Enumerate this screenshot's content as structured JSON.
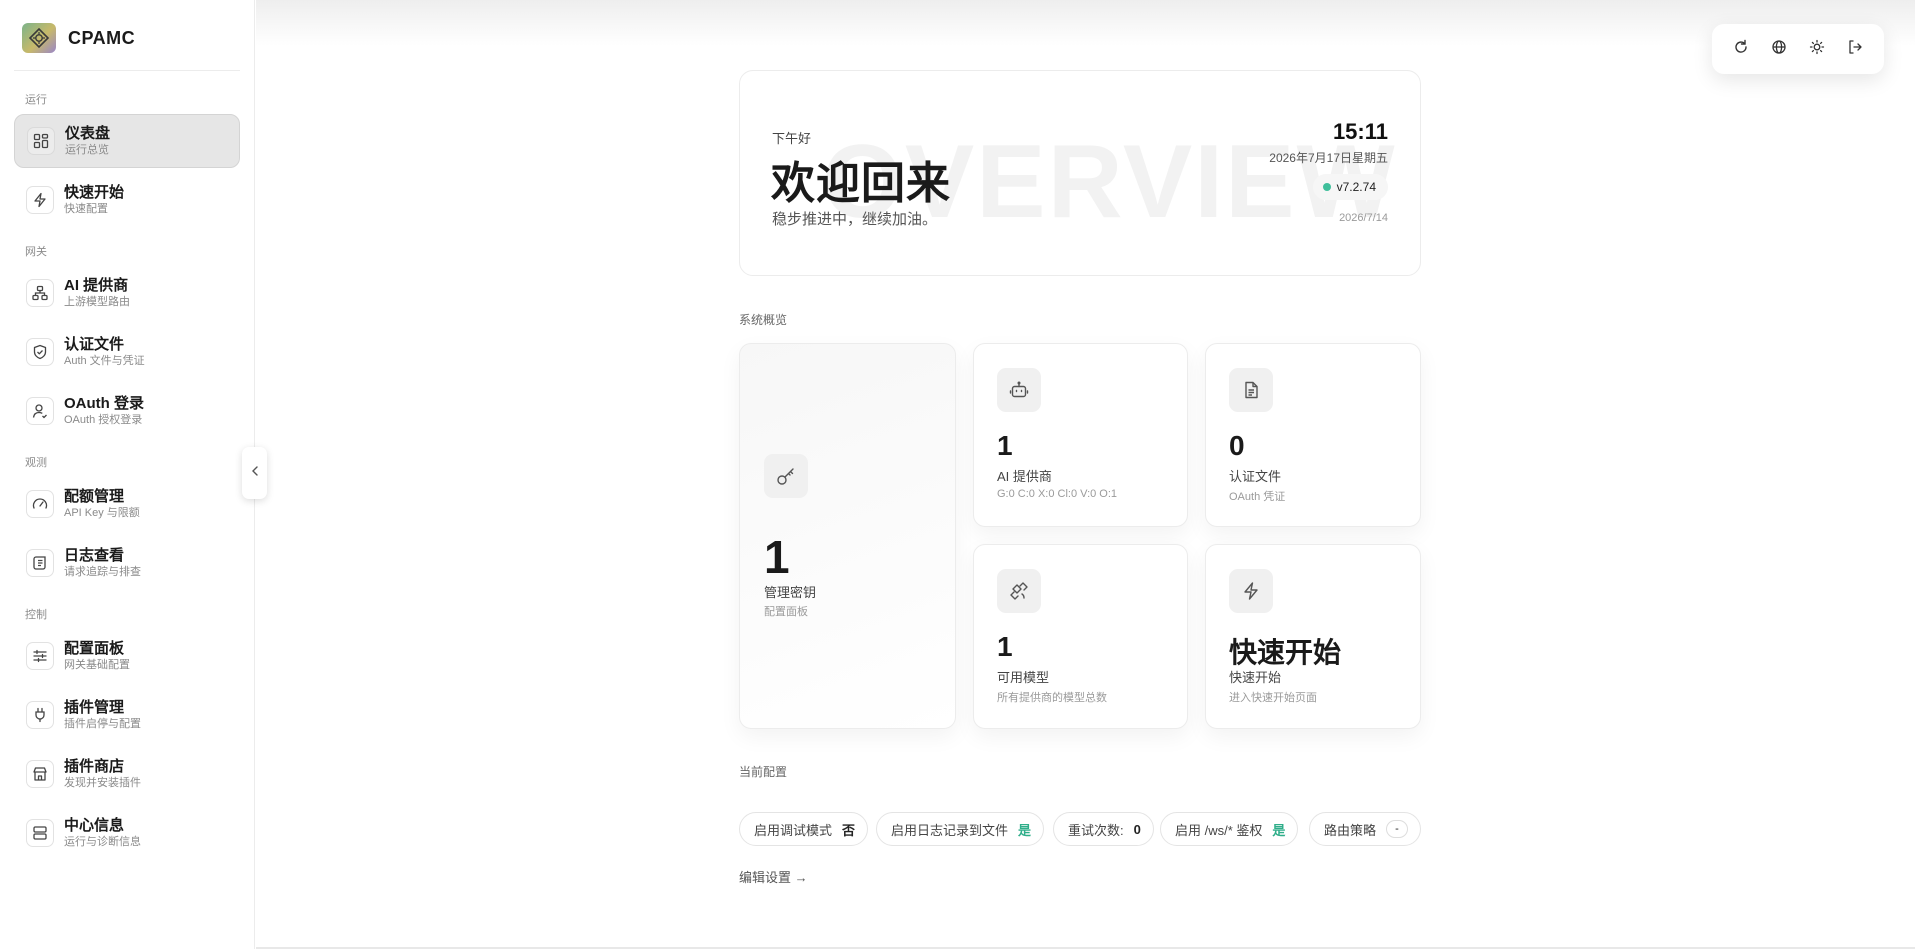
{
  "brand": {
    "name": "CPAMC"
  },
  "sidebar": {
    "sections": {
      "run": "运行",
      "gateway": "网关",
      "observe": "观测",
      "control": "控制"
    },
    "items": [
      {
        "title": "仪表盘",
        "sub": "运行总览",
        "icon": "dashboard-icon",
        "active": true
      },
      {
        "title": "快速开始",
        "sub": "快速配置",
        "icon": "lightning-icon"
      },
      {
        "title": "AI 提供商",
        "sub": "上游模型路由",
        "icon": "network-icon"
      },
      {
        "title": "认证文件",
        "sub": "Auth 文件与凭证",
        "icon": "shield-icon"
      },
      {
        "title": "OAuth 登录",
        "sub": "OAuth 授权登录",
        "icon": "user-icon"
      },
      {
        "title": "配额管理",
        "sub": "API Key 与限额",
        "icon": "gauge-icon"
      },
      {
        "title": "日志查看",
        "sub": "请求追踪与排查",
        "icon": "scroll-icon"
      },
      {
        "title": "配置面板",
        "sub": "网关基础配置",
        "icon": "sliders-icon"
      },
      {
        "title": "插件管理",
        "sub": "插件启停与配置",
        "icon": "plug-icon"
      },
      {
        "title": "插件商店",
        "sub": "发现并安装插件",
        "icon": "store-icon"
      },
      {
        "title": "中心信息",
        "sub": "运行与诊断信息",
        "icon": "server-icon"
      }
    ]
  },
  "toolbar": {
    "icons": [
      "refresh-icon",
      "globe-icon",
      "sun-icon",
      "logout-icon"
    ]
  },
  "welcome": {
    "watermark": "OVERVIEW",
    "greeting": "下午好",
    "title": "欢迎回来",
    "subtitle": "稳步推进中，继续加油。",
    "time": "15:11",
    "date": "2026年7月17日星期五",
    "version": "v7.2.74",
    "build_date": "2026/7/14",
    "status_color": "#3fbf9b"
  },
  "overview": {
    "label": "系统概览",
    "cards": {
      "keys": {
        "value": "1",
        "label": "管理密钥",
        "sub": "配置面板",
        "icon": "key-icon"
      },
      "providers": {
        "value": "1",
        "label": "AI 提供商",
        "sub": "G:0 C:0 X:0 Cl:0 V:0 O:1",
        "icon": "robot-icon"
      },
      "auth": {
        "value": "0",
        "label": "认证文件",
        "sub": "OAuth 凭证",
        "icon": "file-icon"
      },
      "models": {
        "value": "1",
        "label": "可用模型",
        "sub": "所有提供商的模型总数",
        "icon": "satellite-icon"
      },
      "quick": {
        "value": "快速开始",
        "label": "快速开始",
        "sub": "进入快速开始页面",
        "icon": "lightning-icon"
      }
    }
  },
  "config": {
    "label": "当前配置",
    "chips": [
      {
        "label": "启用调试模式",
        "value": "否"
      },
      {
        "label": "启用日志记录到文件",
        "value": "是"
      },
      {
        "label": "重试次数:",
        "value": "0"
      },
      {
        "label": "启用 /ws/* 鉴权",
        "value": "是"
      },
      {
        "label": "路由策略",
        "value": "-"
      }
    ],
    "edit_link": "编辑设置 →"
  }
}
